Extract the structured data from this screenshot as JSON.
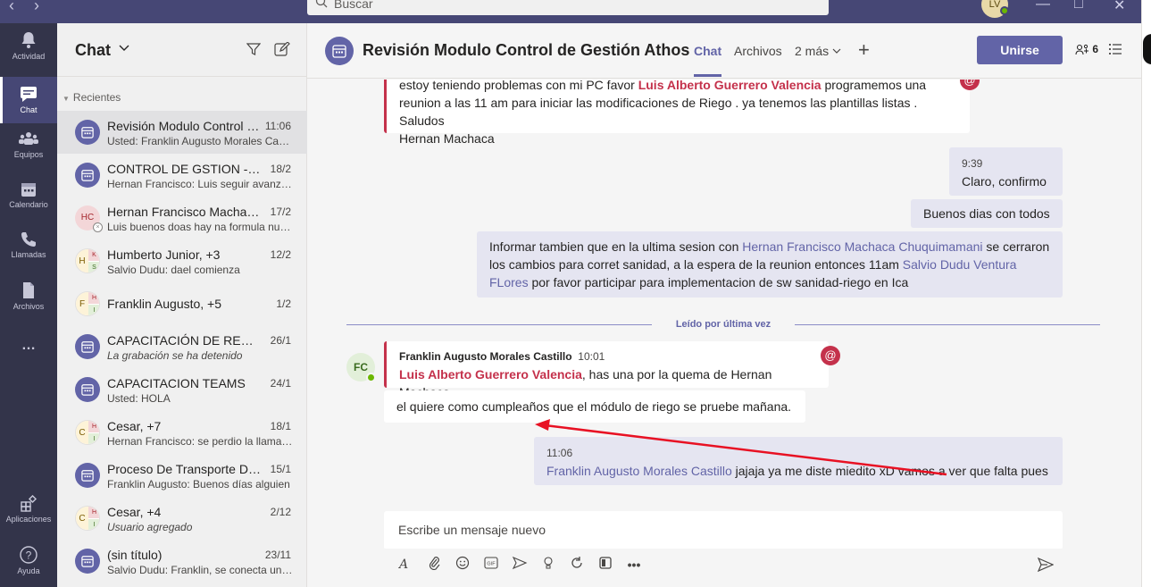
{
  "topbar": {
    "back_icon": "chevron-left-icon",
    "forward_icon": "chevron-right-icon",
    "search_placeholder": "Buscar",
    "avatar_initials": "LV",
    "window_controls": [
      "—",
      "□",
      "✕"
    ]
  },
  "rail": {
    "items": [
      {
        "label": "Actividad",
        "icon": "bell-icon"
      },
      {
        "label": "Chat",
        "icon": "chat-icon",
        "active": true
      },
      {
        "label": "Equipos",
        "icon": "teams-icon"
      },
      {
        "label": "Calendario",
        "icon": "calendar-icon"
      },
      {
        "label": "Llamadas",
        "icon": "phone-icon"
      },
      {
        "label": "Archivos",
        "icon": "files-icon"
      },
      {
        "label": "…",
        "icon": "more-icon"
      },
      {
        "label": "Aplicaciones",
        "icon": "apps-icon"
      },
      {
        "label": "Ayuda",
        "icon": "help-icon"
      }
    ]
  },
  "list": {
    "title": "Chat",
    "section": "Recientes",
    "chats": [
      {
        "name": "Revisión Modulo Control de Gestión Athos",
        "time": "11:06",
        "preview": "Usted: Franklin Augusto Morales Castillo jajaja ya me diste miedito",
        "avatar": "meeting"
      },
      {
        "name": "CONTROL DE GSTION - SANIDAD",
        "time": "18/2",
        "preview": "Hernan Francisco: Luis seguir avanzando",
        "avatar": "meeting"
      },
      {
        "name": "Hernan Francisco Machaca Chuquimamani",
        "time": "17/2",
        "preview": "Luis buenos doas hay na formula nueva",
        "avatar": "HC"
      },
      {
        "name": "Humberto Junior, +3",
        "time": "12/2",
        "preview": "Salvio Dudu: dael comienza",
        "avatar": "group",
        "initials": [
          "H",
          "K",
          "S"
        ]
      },
      {
        "name": "Franklin Augusto, +5",
        "time": "1/2",
        "preview": "",
        "avatar": "group",
        "initials": [
          "F",
          "H",
          "I"
        ]
      },
      {
        "name": "CAPACITACIÓN DE REFORZAMIENTO",
        "time": "26/1",
        "preview": "La grabación se ha detenido",
        "avatar": "meeting",
        "italic": true
      },
      {
        "name": "CAPACITACION TEAMS",
        "time": "24/1",
        "preview": "Usted: HOLA",
        "avatar": "meeting"
      },
      {
        "name": "Cesar, +7",
        "time": "18/1",
        "preview": "Hernan Francisco: se perdio la llamada",
        "avatar": "group",
        "initials": [
          "C",
          "H",
          "I"
        ]
      },
      {
        "name": "Proceso De Transporte De Datos",
        "time": "15/1",
        "preview": "Franklin Augusto: Buenos días alguien",
        "avatar": "meeting"
      },
      {
        "name": "Cesar, +4",
        "time": "2/12",
        "preview": "Usuario agregado",
        "avatar": "group",
        "initials": [
          "C",
          "H",
          "I"
        ],
        "italic": true
      },
      {
        "name": "(sin título)",
        "time": "23/11",
        "preview": "Salvio Dudu: Franklin, se conecta un rato",
        "avatar": "meeting"
      }
    ]
  },
  "main": {
    "title": "Revisión Modulo Control de Gestión Athos",
    "tabs": [
      "Chat",
      "Archivos",
      "2 más"
    ],
    "join_label": "Unirse",
    "participants_count": "6",
    "read_marker": "Leído por última vez",
    "compose_placeholder": "Escribe un mensaje nuevo"
  },
  "messages": {
    "m1": {
      "pre": "estoy teniendo problemas con mi PC favor ",
      "mention": "Luis Alberto Guerrero Valencia",
      "post": " programemos una",
      "line2": "reunion a las 11 am para iniciar las modificaciones de Riego . ya tenemos las plantillas listas . Saludos",
      "line3": "Hernan Machaca"
    },
    "m2": {
      "time": "9:39",
      "text": "Claro, confirmo"
    },
    "m3": {
      "text": "Buenos dias con todos"
    },
    "m4": {
      "pre": "Informar tambien que en la ultima sesion con ",
      "link1": "Hernan Francisco Machaca Chuquimamani",
      "mid1": " se cerraron",
      "line2_pre": "los cambios para corret sanidad, a la espera de la reunion entonces 11am ",
      "link2a": "Salvio Dudu Ventura",
      "link2b": "FLores",
      "line3_post": " por favor participar para implementacion de sw sanidad-riego en Ica"
    },
    "m5": {
      "author": "Franklin Augusto Morales Castillo",
      "time": "10:01",
      "avatar_initials": "FC",
      "mention": "Luis Alberto Guerrero Valencia",
      "post": ", has una por la quema de Hernan Machaca"
    },
    "m6": {
      "text": "el quiere como cumpleaños que el módulo de riego se pruebe mañana."
    },
    "m7": {
      "time": "11:06",
      "link": "Franklin Augusto Morales Castillo",
      "text": " jajaja ya me diste miedito xD vamos a ver que falta pues"
    }
  },
  "colors": {
    "brand": "#6264a7",
    "topbar": "#464775",
    "rail": "#33344a",
    "mention": "#c4314b",
    "annotation_arrow": "#e81123"
  }
}
